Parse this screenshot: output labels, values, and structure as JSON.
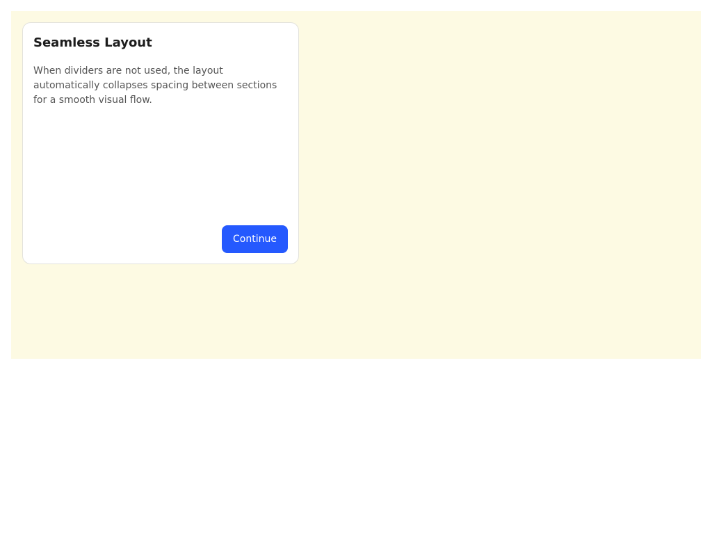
{
  "card": {
    "title": "Seamless Layout",
    "body": "When dividers are not used, the layout automatically collapses spacing between sections for a smooth visual flow.",
    "continue_label": "Continue"
  },
  "colors": {
    "page_background": "#fdfae3",
    "card_background": "#ffffff",
    "accent": "#2559fe"
  }
}
